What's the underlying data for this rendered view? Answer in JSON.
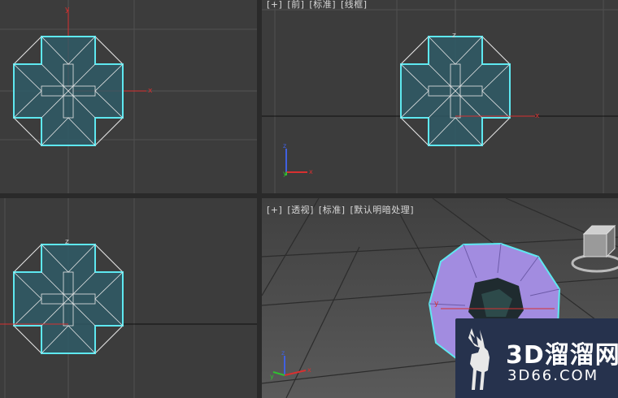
{
  "viewports": {
    "top": {
      "name": "top"
    },
    "front": {
      "labels": [
        "[+]",
        "[前]",
        "[标准]",
        "[线框]"
      ]
    },
    "left": {
      "name": "left"
    },
    "perspective": {
      "labels": [
        "[+]",
        "[透视]",
        "[标准]",
        "[默认明暗处理]"
      ],
      "active": true
    }
  },
  "axes": {
    "x": "x",
    "y": "y",
    "z": "z"
  },
  "colors": {
    "viewport_bg": "#3c3c3c",
    "perspective_bg": "#4a4a4a",
    "selection_outline": "#5ee8f0",
    "wire": "#e8e8e8",
    "object_fill": "#2f5a66",
    "sphere_fill": "#a28ce0",
    "axis_x": "#d83030",
    "axis_y": "#30c030",
    "axis_z": "#4060e0",
    "active_border": "#c9b45a"
  },
  "watermark": {
    "line1": "3D溜溜网",
    "line2": "3D66.COM",
    "icon": "deer-logo-icon"
  }
}
